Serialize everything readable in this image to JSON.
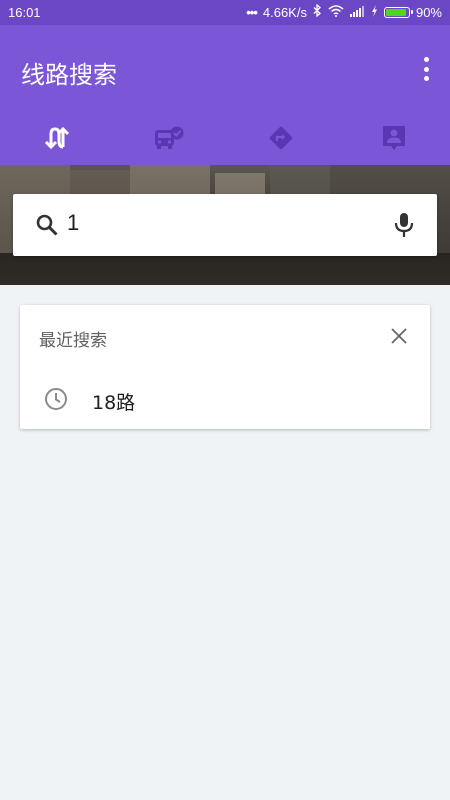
{
  "status_bar": {
    "time": "16:01",
    "network_speed": "4.66K/s",
    "battery_percent": "90%",
    "battery_level": 0.9,
    "icons": [
      "bluetooth-icon",
      "wifi-icon",
      "signal-icon",
      "charging-icon",
      "battery-icon"
    ]
  },
  "app_bar": {
    "title": "线路搜索",
    "menu_icon": "more-vert-icon"
  },
  "tabs": [
    {
      "name": "route-search",
      "icon": "swap-vert-icon",
      "selected": true
    },
    {
      "name": "bus",
      "icon": "bus-check-icon",
      "selected": false
    },
    {
      "name": "directions",
      "icon": "directions-icon",
      "selected": false
    },
    {
      "name": "contact",
      "icon": "person-pin-icon",
      "selected": false
    }
  ],
  "search": {
    "value": "1",
    "search_icon": "search-icon",
    "mic_icon": "mic-icon"
  },
  "recent": {
    "heading": "最近搜索",
    "close_icon": "close-icon",
    "items": [
      {
        "label": "18路",
        "icon": "history-icon"
      }
    ]
  },
  "colors": {
    "status_bar": "#6b47c6",
    "app_bar": "#7b57d8",
    "tab_icon_selected": "#ffffff",
    "tab_icon_unselected": "#5a36b2",
    "background": "#f0f3f6",
    "battery_fill": "#54d21c"
  }
}
